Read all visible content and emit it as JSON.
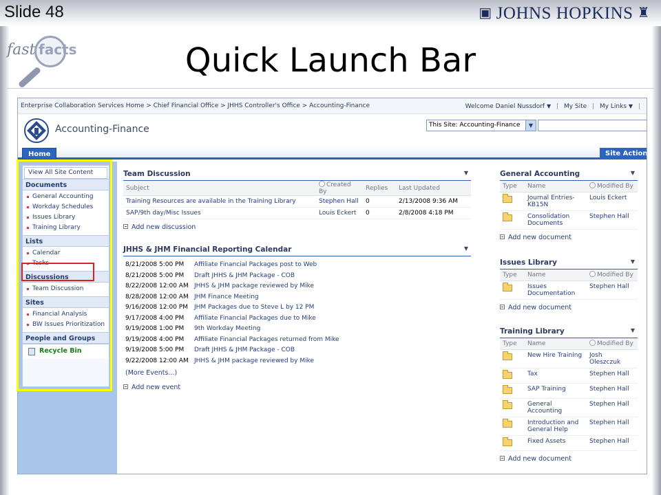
{
  "slide": {
    "number_label": "Slide 48",
    "logo_text": "JOHNS HOPKINS",
    "badge_left": "fast",
    "badge_right": "facts",
    "title": "Quick Launch Bar"
  },
  "sharepoint": {
    "breadcrumb": "Enterprise Collaboration Services Home > Chief Financial Office > JHHS Controller's Office > Accounting-Finance",
    "welcome": "Welcome Daniel Nussdorf",
    "my_site": "My Site",
    "my_links": "My Links",
    "site_title": "Accounting-Finance",
    "search_scope": "This Site: Accounting-Finance",
    "home_tab": "Home",
    "site_actions": "Site Actions"
  },
  "quick_launch": {
    "view_all": "View All Site Content",
    "sections": [
      {
        "heading": "Documents",
        "items": [
          "General Accounting",
          "Workday Schedules",
          "Issues Library",
          "Training Library"
        ]
      },
      {
        "heading": "Lists",
        "items": [
          "Calendar",
          "Tasks"
        ]
      },
      {
        "heading": "Discussions",
        "items": [
          "Team Discussion"
        ]
      },
      {
        "heading": "Sites",
        "items": [
          "Financial Analysis",
          "BW Issues Prioritization"
        ]
      },
      {
        "heading": "People and Groups",
        "items": []
      }
    ],
    "recycle_bin": "Recycle Bin"
  },
  "team_discussion": {
    "title": "Team Discussion",
    "columns": [
      "Subject",
      "Created By",
      "Replies",
      "Last Updated"
    ],
    "rows": [
      [
        "Training Resources are available in the Training Library",
        "Stephen Hall",
        "0",
        "2/13/2008 9:36 AM"
      ],
      [
        "SAP/9th day/Misc Issues",
        "Louis Eckert",
        "0",
        "2/8/2008 4:18 PM"
      ]
    ],
    "add_link": "Add new discussion"
  },
  "calendar": {
    "title": "JHHS & JHM Financial Reporting Calendar",
    "events": [
      [
        "8/21/2008 5:00 PM",
        "Affiliate Financial Packages post to Web"
      ],
      [
        "8/21/2008 5:00 PM",
        "Draft JHHS & JHM Package - COB"
      ],
      [
        "8/22/2008 12:00 AM",
        "JHHS & JHM package reviewed by Mike"
      ],
      [
        "8/28/2008 12:00 AM",
        "JHM Finance Meeting"
      ],
      [
        "9/16/2008 12:00 PM",
        "JHM Packages due to Steve L by 12 PM"
      ],
      [
        "9/17/2008 4:00 PM",
        "Affiliate Financial Packages due to Mike"
      ],
      [
        "9/19/2008 1:00 PM",
        "9th Workday Meeting"
      ],
      [
        "9/19/2008 4:00 PM",
        "Affiliate Financial Packages returned from Mike"
      ],
      [
        "9/19/2008 5:00 PM",
        "Draft JHHS & JHM Package - COB"
      ],
      [
        "9/22/2008 12:00 AM",
        "JHHS & JHM package reviewed by Mike"
      ]
    ],
    "more": "(More Events...)",
    "add_link": "Add new event"
  },
  "doc_libraries": {
    "columns": [
      "Type",
      "Name",
      "Modified By"
    ],
    "general_accounting": {
      "title": "General Accounting",
      "rows": [
        [
          "Journal Entries- KB15N",
          "Louis Eckert"
        ],
        [
          "Consolidation Documents",
          "Stephen Hall"
        ]
      ],
      "add_link": "Add new document"
    },
    "issues_library": {
      "title": "Issues Library",
      "rows": [
        [
          "Issues Documentation",
          "Stephen Hall"
        ]
      ],
      "add_link": "Add new document"
    },
    "training_library": {
      "title": "Training Library",
      "rows": [
        [
          "New Hire Training",
          "Josh Oleszczuk"
        ],
        [
          "Tax",
          "Stephen Hall"
        ],
        [
          "SAP Training",
          "Stephen Hall"
        ],
        [
          "General Accounting",
          "Stephen Hall"
        ],
        [
          "Introduction and General Help",
          "Stephen Hall"
        ],
        [
          "Fixed Assets",
          "Stephen Hall"
        ]
      ],
      "add_link": "Add new document"
    }
  },
  "colors": {
    "accent_blue": "#2c64c2",
    "highlight_yellow": "#ffff00",
    "highlight_red": "#e02020",
    "quicklaunch_bg": "#aac5ea"
  }
}
